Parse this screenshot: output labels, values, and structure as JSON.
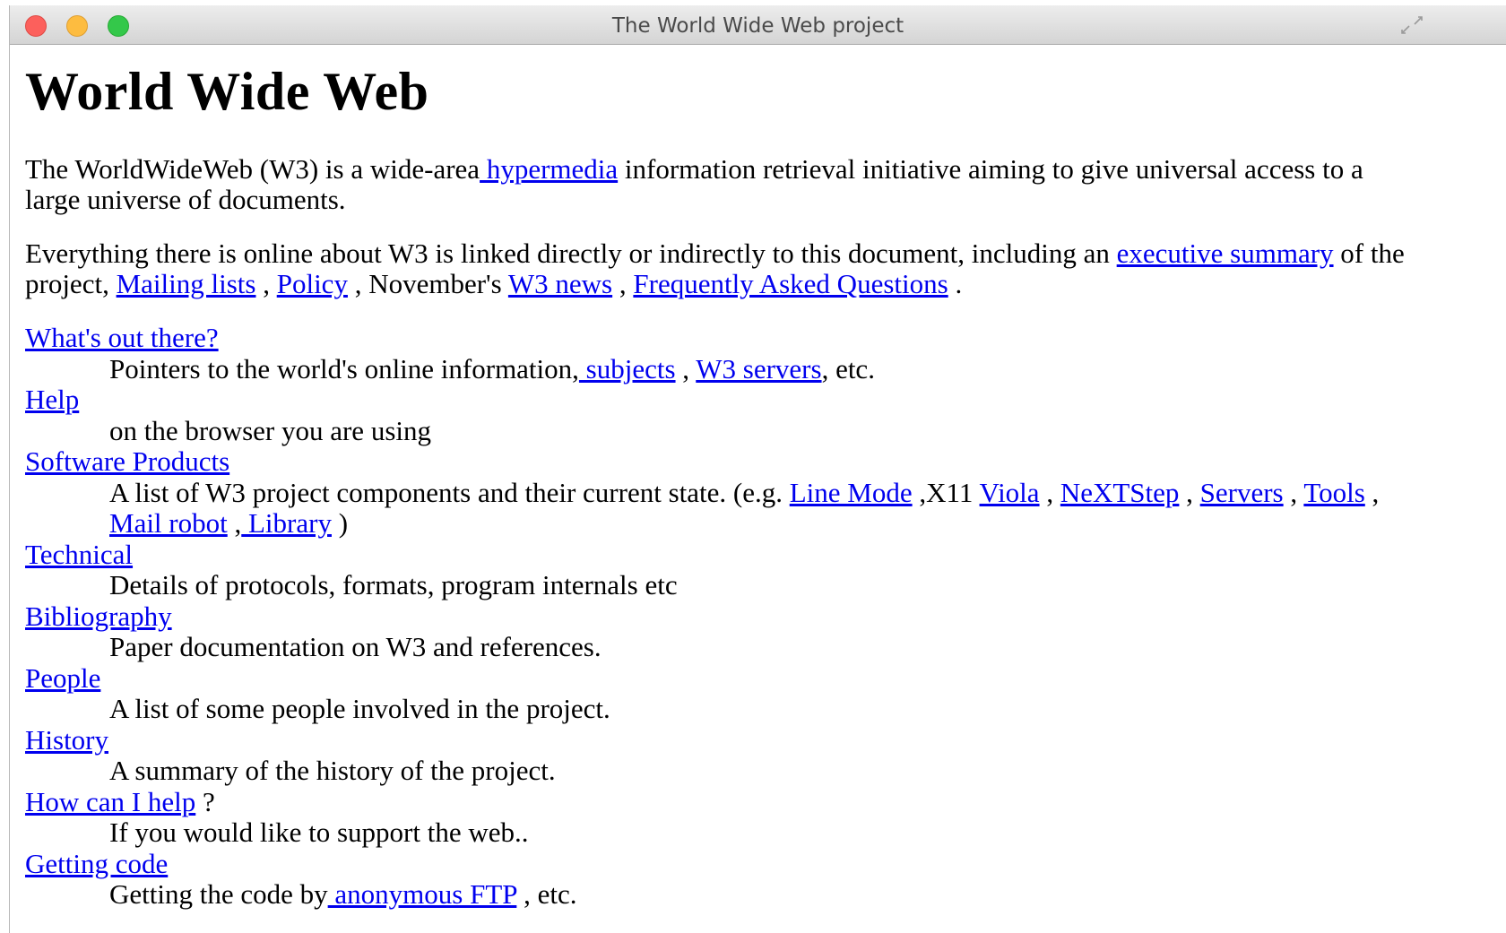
{
  "window": {
    "title": "The World Wide Web project"
  },
  "heading": "World Wide Web",
  "intro": {
    "text1": "The WorldWideWeb (W3) is a wide-area",
    "link_hypermedia": " hypermedia",
    "text2": " information retrieval initiative aiming to give universal access to a large universe of documents."
  },
  "para2": {
    "text1": "Everything there is online about W3 is linked directly or indirectly to this document, including an ",
    "link_exec_summary": "executive summary",
    "text2": " of the project, ",
    "link_mailing_lists": "Mailing lists",
    "sep1": " , ",
    "link_policy": "Policy",
    "text3": " , November's ",
    "link_w3_news": "W3 news",
    "sep2": " , ",
    "link_faq": "Frequently Asked Questions",
    "end": " ."
  },
  "sections": {
    "whats_out": {
      "title": "What's out there?",
      "desc1": "Pointers to the world's online information,",
      "link_subjects": " subjects",
      "sep": " , ",
      "link_w3_servers": "W3 servers",
      "desc2": ", etc."
    },
    "help": {
      "title": "Help",
      "desc": "on the browser you are using"
    },
    "software": {
      "title": "Software Products",
      "desc1": "A list of W3 project components and their current state. (e.g. ",
      "link_line_mode": "Line Mode",
      "sep1": " ,X11 ",
      "link_viola": "Viola",
      "sep2": " , ",
      "link_nextstep": "NeXTStep",
      "sep3": " , ",
      "link_servers": "Servers",
      "sep4": " , ",
      "link_tools": "Tools",
      "sep5": " ,",
      "link_mail_robot": " Mail robot",
      "sep6": " ,",
      "link_library": " Library",
      "end": " )"
    },
    "technical": {
      "title": "Technical",
      "desc": "Details of protocols, formats, program internals etc"
    },
    "bibliography": {
      "title": "Bibliography",
      "desc": "Paper documentation on W3 and references."
    },
    "people": {
      "title": "People",
      "desc": "A list of some people involved in the project."
    },
    "history": {
      "title": "History",
      "desc": "A summary of the history of the project."
    },
    "how_help": {
      "title": "How can I help",
      "suffix": " ?",
      "desc": "If you would like to support the web.."
    },
    "getting_code": {
      "title": "Getting code",
      "desc1": "Getting the code by",
      "link_ftp": " anonymous FTP",
      "desc2": " , etc."
    }
  },
  "colors": {
    "link": "#0000ee",
    "text": "#000000",
    "close": "#fc605c",
    "minimize": "#fdbc40",
    "maximize": "#34c84a"
  },
  "icons": {
    "close": "close-dot",
    "minimize": "minimize-dot",
    "maximize": "maximize-dot",
    "fullscreen": "fullscreen-arrows-icon"
  }
}
